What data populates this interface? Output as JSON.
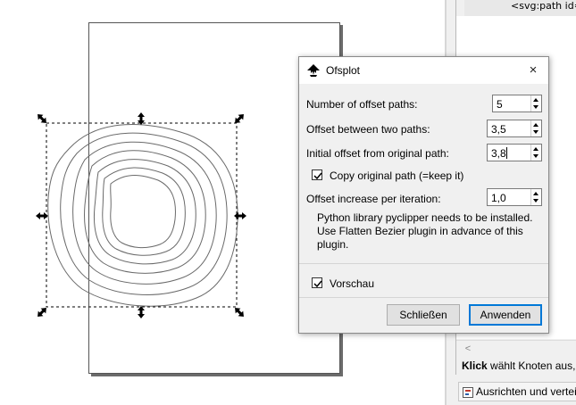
{
  "dialog": {
    "title": "Ofsplot",
    "close_icon": "×",
    "fields": [
      {
        "label": "Number of offset paths:",
        "value": "5"
      },
      {
        "label": "Offset between two paths:",
        "value": "3,5"
      },
      {
        "label": "Initial offset from original path:",
        "value": "3,8"
      },
      {
        "label": "Offset increase per iteration:",
        "value": "1,0"
      }
    ],
    "copy_original": {
      "label": "Copy original path (=keep it)",
      "checked": true
    },
    "info": "Python library pyclipper needs to be installed. Use Flatten Bezier plugin in advance of this plugin.",
    "preview": {
      "label": "Vorschau",
      "checked": true
    },
    "buttons": {
      "close": "Schließen",
      "apply": "Anwenden"
    }
  },
  "xml_editor": {
    "node_text": "<svg:path id="
  },
  "statusbar": {
    "bold": "Klick",
    "text": " wählt Knoten aus, Z"
  },
  "align_tab": {
    "label": "Ausrichten und vertei",
    "icon": "align-distribute-icon"
  },
  "icons": {
    "app": "inkscape-icon",
    "resize_handle": "resize-arrow-icon",
    "scroll_left": "chevron-left-icon"
  },
  "colors": {
    "accent": "#0078d7",
    "path_stroke": "#6a6a6a"
  }
}
